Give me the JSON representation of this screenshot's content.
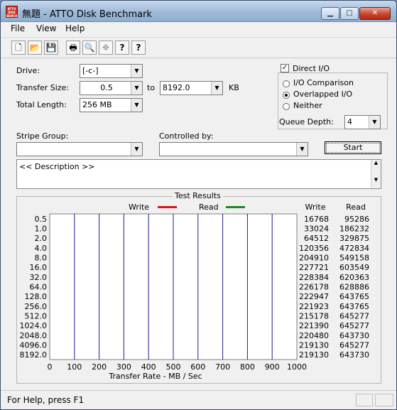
{
  "window": {
    "title": "無題 - ATTO Disk Benchmark",
    "icon_text": "ATTO DISK BENCH",
    "minimize_symbol": "▁",
    "maximize_symbol": "□",
    "close_symbol": "✕"
  },
  "menu": [
    "File",
    "View",
    "Help"
  ],
  "toolbar": [
    {
      "name": "new-icon",
      "glyph": "🗋"
    },
    {
      "name": "open-icon",
      "glyph": "📂"
    },
    {
      "name": "save-icon",
      "glyph": "💾"
    },
    {
      "name": "print-icon",
      "glyph": "🖶"
    },
    {
      "name": "print-preview-icon",
      "glyph": "🔍"
    },
    {
      "name": "move-icon",
      "glyph": "✥"
    },
    {
      "name": "help-icon",
      "glyph": "?"
    },
    {
      "name": "context-help-icon",
      "glyph": "?"
    }
  ],
  "form": {
    "drive_label": "Drive:",
    "drive_value": "[-c-]",
    "transfer_size_label": "Transfer Size:",
    "transfer_from": "0.5",
    "to_label": "to",
    "transfer_to": "8192.0",
    "kb_label": "KB",
    "total_length_label": "Total Length:",
    "total_length_value": "256 MB",
    "direct_io_label": "Direct I/O",
    "direct_io_checked": true,
    "io_options": [
      "I/O Comparison",
      "Overlapped I/O",
      "Neither"
    ],
    "io_selected": "Overlapped I/O",
    "queue_depth_label": "Queue Depth:",
    "queue_depth_value": "4",
    "stripe_group_label": "Stripe Group:",
    "stripe_group_value": "",
    "controlled_by_label": "Controlled by:",
    "controlled_by_value": "",
    "start_label": "Start",
    "description_text": "<< Description >>"
  },
  "results": {
    "title": "Test Results",
    "legend_write": "Write",
    "legend_read": "Read",
    "col_write": "Write",
    "col_read": "Read",
    "xlabel": "Transfer Rate - MB / Sec"
  },
  "chart_data": {
    "type": "bar",
    "orientation": "horizontal",
    "categories": [
      "0.5",
      "1.0",
      "2.0",
      "4.0",
      "8.0",
      "16.0",
      "32.0",
      "64.0",
      "128.0",
      "256.0",
      "512.0",
      "1024.0",
      "2048.0",
      "4096.0",
      "8192.0"
    ],
    "series": [
      {
        "name": "Write",
        "color": "#e21212",
        "values": [
          16768,
          33024,
          64512,
          120356,
          204910,
          227721,
          228384,
          226178,
          222947,
          221923,
          215178,
          221390,
          220480,
          219130,
          219130
        ]
      },
      {
        "name": "Read",
        "color": "#1a8a1a",
        "values": [
          95286,
          186232,
          329875,
          472834,
          549158,
          603549,
          620363,
          628886,
          643765,
          643765,
          645277,
          645277,
          643730,
          645277,
          643730
        ]
      }
    ],
    "xlabel": "Transfer Rate - MB / Sec",
    "xlim": [
      0,
      1000
    ],
    "xticks": [
      0,
      100,
      200,
      300,
      400,
      500,
      600,
      700,
      800,
      900,
      1000
    ],
    "grid": true,
    "legend": "top-center"
  },
  "status": {
    "help_text": "For Help, press F1"
  }
}
